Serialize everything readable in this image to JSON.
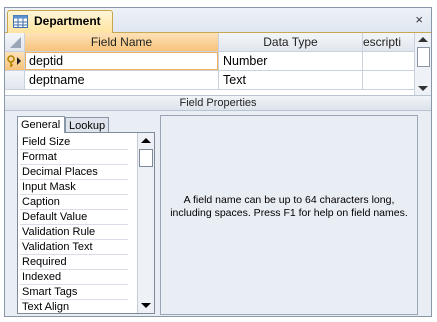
{
  "window": {
    "tab_title": "Department",
    "close_glyph": "×"
  },
  "grid": {
    "headers": [
      "Field Name",
      "Data Type",
      "escripti"
    ],
    "rows": [
      {
        "field_name": "deptid",
        "data_type": "Number",
        "description": "",
        "primary_key": true
      },
      {
        "field_name": "deptname",
        "data_type": "Text",
        "description": "",
        "primary_key": false
      }
    ]
  },
  "field_properties": {
    "bar_label": "Field Properties",
    "tabs": [
      "General",
      "Lookup"
    ],
    "active_tab": "General",
    "items": [
      "Field Size",
      "Format",
      "Decimal Places",
      "Input Mask",
      "Caption",
      "Default Value",
      "Validation Rule",
      "Validation Text",
      "Required",
      "Indexed",
      "Smart Tags",
      "Text Align"
    ],
    "help_text": "A field name can be up to 64 characters long, including spaces.  Press F1 for help on field names."
  },
  "colors": {
    "active_header": "#f7c37a",
    "tab_gold": "#ffe3a0",
    "panel_bg": "#e9edf4"
  }
}
